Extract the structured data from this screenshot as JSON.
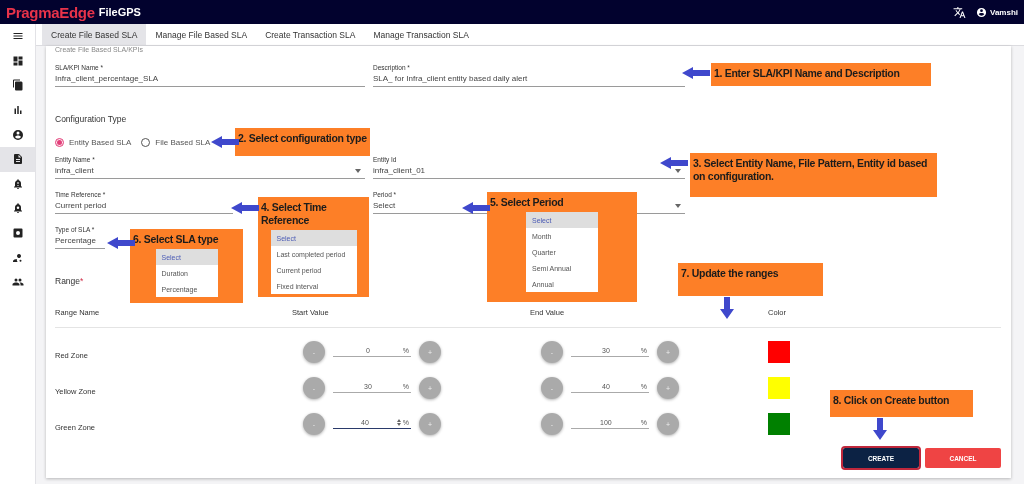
{
  "header": {
    "brand": "PragmaEdge",
    "product": "FileGPS",
    "user": "Vamshi"
  },
  "sidebar": {
    "items": [
      {
        "kind": "menu",
        "selected": false
      },
      {
        "kind": "dashboard",
        "selected": false
      },
      {
        "kind": "files",
        "selected": false
      },
      {
        "kind": "chart",
        "selected": false
      },
      {
        "kind": "account",
        "selected": false
      },
      {
        "kind": "document",
        "selected": true
      },
      {
        "kind": "alert",
        "selected": false
      },
      {
        "kind": "alert-settings",
        "selected": false
      },
      {
        "kind": "settings",
        "selected": false
      },
      {
        "kind": "user-settings",
        "selected": false
      },
      {
        "kind": "group",
        "selected": false
      }
    ]
  },
  "tabs": [
    {
      "label": "Create File Based SLA",
      "selected": true
    },
    {
      "label": "Manage File Based SLA",
      "selected": false
    },
    {
      "label": "Create Transaction SLA",
      "selected": false
    },
    {
      "label": "Manage Transaction SLA",
      "selected": false
    }
  ],
  "form": {
    "heading": "Create File Based SLA/KPIs",
    "fields": [
      {
        "label": "SLA/KPI Name *",
        "value": "Infra_client_percentage_SLA",
        "kind": "text"
      },
      {
        "label": "Description *",
        "value": "SLA_ for Infra_client entity based daily alert",
        "kind": "text"
      }
    ],
    "configuration_type": {
      "label": "Configuration Type",
      "options": [
        {
          "label": "Entity Based SLA",
          "selected": true
        },
        {
          "label": "File Based SLA",
          "selected": false
        }
      ]
    },
    "detail_fields": [
      {
        "label": "Entity Name *",
        "value": "infra_client",
        "kind": "select"
      },
      {
        "label": "Entity Id",
        "value": "infra_client_01",
        "kind": "select"
      },
      {
        "label": "Time Reference *",
        "value": "Current period",
        "kind": "text"
      },
      {
        "label": "Period *",
        "value": "Select",
        "kind": "select"
      },
      {
        "label": "Type of SLA *",
        "value": "Percentage",
        "kind": "text"
      }
    ]
  },
  "range": {
    "label": "Range",
    "required_mark": "*",
    "columns": [
      "Range Name",
      "Start Value",
      "End Value",
      "Color"
    ],
    "rows": [
      {
        "name": "Red Zone",
        "start": {
          "minus": "-",
          "value": "0",
          "unit": "%",
          "plus": "+",
          "focused": false
        },
        "end": {
          "minus": "-",
          "value": "30",
          "unit": "%",
          "plus": "+",
          "focused": false
        },
        "color": "#ff0000"
      },
      {
        "name": "Yellow Zone",
        "start": {
          "minus": "-",
          "value": "30",
          "unit": "%",
          "plus": "+",
          "focused": false
        },
        "end": {
          "minus": "-",
          "value": "40",
          "unit": "%",
          "plus": "+",
          "focused": false
        },
        "color": "#ffff00"
      },
      {
        "name": "Green Zone",
        "start": {
          "minus": "-",
          "value": "40",
          "unit": "%",
          "plus": "+",
          "focused": true
        },
        "end": {
          "minus": "-",
          "value": "100",
          "unit": "%",
          "plus": "+",
          "focused": false
        },
        "color": "#008000"
      }
    ]
  },
  "buttons": [
    {
      "label": "CREATE",
      "kind": "primary"
    },
    {
      "label": "CANCEL",
      "kind": "danger"
    }
  ],
  "callouts": [
    {
      "text": "1. Enter SLA/KPI Name and Description",
      "kind": "left"
    },
    {
      "text": "2. Select configuration type",
      "kind": "left"
    },
    {
      "text": "3. Select Entity Name, File Pattern, Entity id based on configuration.",
      "kind": "left"
    },
    {
      "text": "4. Select Time Reference",
      "kind": "left",
      "options": [
        {
          "label": "Select",
          "selected": true
        },
        {
          "label": "Last completed period",
          "selected": false
        },
        {
          "label": "Current period",
          "selected": false
        },
        {
          "label": "Fixed interval",
          "selected": false
        }
      ]
    },
    {
      "text": "5. Select Period",
      "kind": "left",
      "options": [
        {
          "label": "Select",
          "selected": true
        },
        {
          "label": "Month",
          "selected": false
        },
        {
          "label": "Quarter",
          "selected": false
        },
        {
          "label": "Semi Annual",
          "selected": false
        },
        {
          "label": "Annual",
          "selected": false
        }
      ]
    },
    {
      "text": "6. Select SLA type",
      "kind": "left",
      "options": [
        {
          "label": "Select",
          "selected": true
        },
        {
          "label": "Duration",
          "selected": false
        },
        {
          "label": "Percentage",
          "selected": false
        }
      ]
    },
    {
      "text": "7. Update the ranges",
      "kind": "down"
    },
    {
      "text": "8. Click on Create button",
      "kind": "down"
    }
  ]
}
